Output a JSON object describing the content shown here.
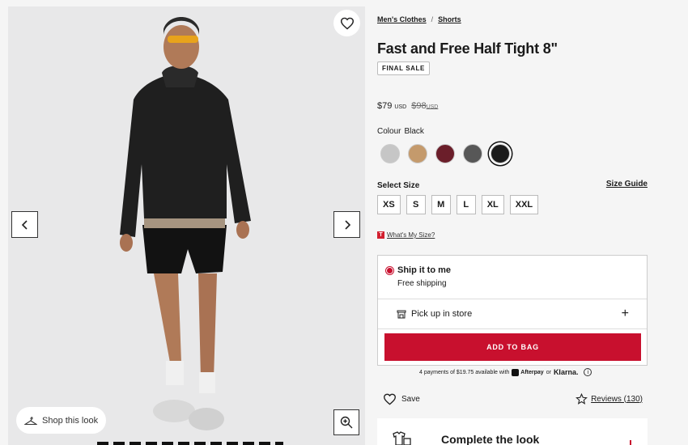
{
  "breadcrumb": {
    "items": [
      "Men's Clothes",
      "Shorts"
    ],
    "separator": "/"
  },
  "product": {
    "title": "Fast and Free Half Tight 8\"",
    "badge": "FINAL SALE",
    "price": "$79",
    "price_currency": "USD",
    "original_price": "$98",
    "original_currency": "USD"
  },
  "colour": {
    "label": "Colour",
    "selected": "Black",
    "swatches": [
      {
        "name": "grey",
        "hex": "#c6c6c6"
      },
      {
        "name": "tan",
        "hex": "#c49a6c"
      },
      {
        "name": "burgundy",
        "hex": "#6b1e2a"
      },
      {
        "name": "charcoal",
        "hex": "#575757"
      },
      {
        "name": "black",
        "hex": "#1c1c1c"
      }
    ]
  },
  "size": {
    "label": "Select Size",
    "guide": "Size Guide",
    "options": [
      "XS",
      "S",
      "M",
      "L",
      "XL",
      "XXL"
    ],
    "whats_my_size": "What's My Size?"
  },
  "delivery": {
    "ship_title": "Ship it to me",
    "ship_sub": "Free shipping",
    "pickup": "Pick up in store",
    "add_to_bag": "ADD TO BAG"
  },
  "payments": {
    "text": "4 payments of $19.75 available with",
    "afterpay": "Afterpay",
    "or": "or",
    "klarna": "Klarna."
  },
  "actions": {
    "save": "Save",
    "reviews": "Reviews (130)"
  },
  "gallery": {
    "shop_look": "Shop this look"
  },
  "complete_look": {
    "title": "Complete the look"
  },
  "colors": {
    "accent": "#c8102e",
    "background": "#f5f5f5"
  }
}
